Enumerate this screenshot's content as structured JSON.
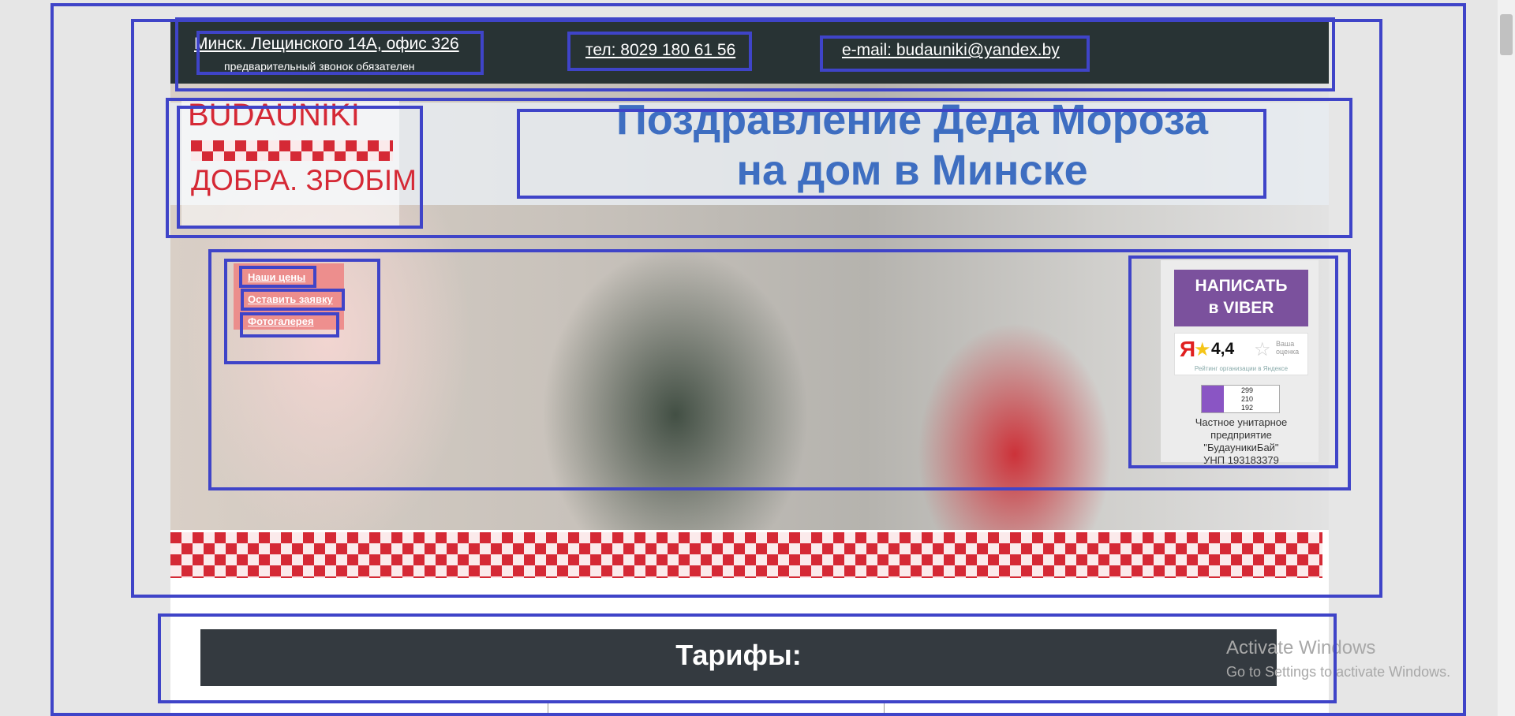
{
  "topbar": {
    "address": "Минск. Лещинского 14А, офис 326",
    "address_note": "предварительный звонок обязателен",
    "phone": "тел: 8029 180 61 56",
    "email": "e-mail: budauniki@yandex.by"
  },
  "logo": {
    "brand": "BUDAUNIKI",
    "slogan": "ДОБРА. ЗРОБІМ"
  },
  "hero": {
    "title_line1": "Поздравление Деда Мороза",
    "title_line2": "на дом в Минске"
  },
  "menu": {
    "items": [
      "Наши цены",
      "Оставить заявку",
      "Фотогалерея"
    ]
  },
  "sidebar": {
    "viber_line1": "НАПИСАТЬ",
    "viber_line2": "в VIBER",
    "yandex_logo": "Я",
    "yandex_score": "4,4",
    "yandex_your_rating": "Ваша оценка",
    "yandex_caption": "Рейтинг организации в Яндексе",
    "counter": [
      "299",
      "210",
      "192"
    ],
    "company_line1": "Частное унитарное",
    "company_line2": "предприятие",
    "company_line3": "\"БудауникиБай\"",
    "company_unp": "УНП 193183379"
  },
  "tariffs": {
    "title": "Тарифы:"
  },
  "watermark": {
    "line1": "Activate Windows",
    "line2": "Go to Settings to activate Windows."
  },
  "colors": {
    "accent_blue": "#3e6ec1",
    "topbar_dark": "#283334",
    "brand_red": "#d52935",
    "viber_purple": "#7b519d",
    "tariffs_dark": "#343a40"
  }
}
